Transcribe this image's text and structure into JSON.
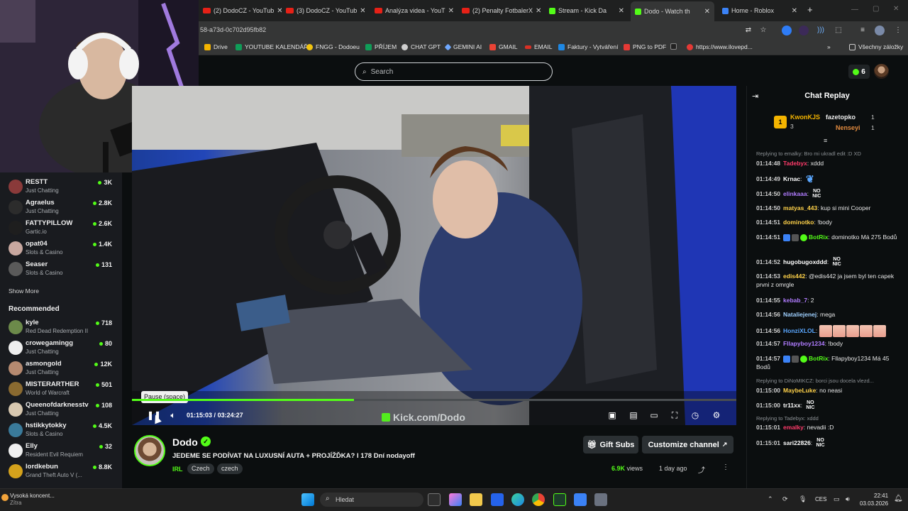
{
  "browser": {
    "tabs": [
      {
        "label": "(2) DodoCZ - YouTub",
        "icon": "youtube-icon"
      },
      {
        "label": "(3) DodoCZ - YouTub",
        "icon": "youtube-icon"
      },
      {
        "label": "Analýza videa - YouT",
        "icon": "youtube-icon"
      },
      {
        "label": "(2) Penalty FotbalerX",
        "icon": "youtube-icon"
      },
      {
        "label": "Stream - Kick Da",
        "icon": "kick-icon"
      },
      {
        "label": "Dodo - Watch th",
        "icon": "kick-icon"
      },
      {
        "label": "Home - Roblox",
        "icon": "roblox-icon"
      }
    ],
    "url": "58-a73d-0c702d95fb82",
    "bookmarks": [
      "Drive",
      "YOUTUBE KALENDÁŘ",
      "FNGG - Dodoeu",
      "PŘÍJEM",
      "CHAT GPT",
      "GEMINI AI",
      "GMAIL",
      "EMAIL",
      "Faktury - Vytváření",
      "PNG to PDF",
      "S",
      "https://www.ilovepd..."
    ],
    "all_bookmarks": "Všechny záložky"
  },
  "header": {
    "search_placeholder": "Search",
    "kick_count": "6"
  },
  "sidebar": {
    "following": [
      {
        "name": "RESTT",
        "category": "Just Chatting",
        "viewers": "3K"
      },
      {
        "name": "Agraelus",
        "category": "Just Chatting",
        "viewers": "2.8K"
      },
      {
        "name": "FATTYPILLOW",
        "category": "Gartic.io",
        "viewers": "2.6K"
      },
      {
        "name": "opat04",
        "category": "Slots & Casino",
        "viewers": "1.4K"
      },
      {
        "name": "Seaser",
        "category": "Slots & Casino",
        "viewers": "131"
      }
    ],
    "show_more": "Show More",
    "recommended_heading": "Recommended",
    "recommended": [
      {
        "name": "kyle",
        "category": "Red Dead Redemption II",
        "viewers": "718"
      },
      {
        "name": "crowegamingg",
        "category": "Just Chatting",
        "viewers": "80"
      },
      {
        "name": "asmongold",
        "category": "Just Chatting",
        "viewers": "12K"
      },
      {
        "name": "MISTERARTHER",
        "category": "World of Warcraft",
        "viewers": "501"
      },
      {
        "name": "Queenofdarknesstv",
        "category": "Just Chatting",
        "viewers": "108"
      },
      {
        "name": "hstikkytokky",
        "category": "Slots & Casino",
        "viewers": "4.5K"
      },
      {
        "name": "Elly",
        "category": "Resident Evil Requiem",
        "viewers": "32"
      },
      {
        "name": "lordkebun",
        "category": "Grand Theft Auto V (...",
        "viewers": "8.8K"
      }
    ]
  },
  "player": {
    "tooltip": "Pause (space)",
    "current_time": "01:15:03",
    "separator": "/",
    "duration": "03:24:27",
    "progress": 0.367,
    "watermark": "Kick.com/Dodo"
  },
  "stream": {
    "streamer": "Dodo",
    "title": "JEDEME SE PODÍVAT NA LUXUSNÍ AUTA + PROJÍŽĎKA? I 178 Dní nodayoff",
    "category": "IRL",
    "tags": [
      "Czech",
      "czech"
    ],
    "views_number": "6.9K",
    "views_label": "views",
    "ago": "1 day ago",
    "gift_subs": "Gift Subs",
    "customize": "Customize channel"
  },
  "chat": {
    "title": "Chat Replay",
    "top_gifters": [
      {
        "name": "KwonKJS",
        "count": "3"
      },
      {
        "name": "fazetopko",
        "count": "1"
      },
      {
        "name": "Nenseyi",
        "count": "1"
      }
    ],
    "messages": [
      {
        "reply": "Replying to emalky: Bro mi ukradl edit :D XD",
        "time": "01:14:48",
        "user": "Tadebyx",
        "color": "#ff3b6a",
        "text": "xddd"
      },
      {
        "time": "01:14:49",
        "user": "Krnac",
        "color": "#ffffff",
        "text": "",
        "emote": "heart"
      },
      {
        "time": "01:14:50",
        "user": "elinkaaa",
        "color": "#b07cff",
        "text": "",
        "emote": "NO NIC"
      },
      {
        "time": "01:14:50",
        "user": "matyas_443",
        "color": "#ffd24a",
        "text": "kup si mini Cooper"
      },
      {
        "time": "01:14:51",
        "user": "dominotko",
        "color": "#ffd24a",
        "text": "!body"
      },
      {
        "time": "01:14:51",
        "user": "BotRix",
        "color": "#53fc18",
        "text": "dominotko Má 275 Bodů",
        "badges": true
      },
      {
        "time": "01:14:52",
        "user": "hugobugoxddd",
        "color": "#ffffff",
        "text": "",
        "emote": "NO NIC"
      },
      {
        "time": "01:14:53",
        "user": "edis442",
        "color": "#ffd24a",
        "text": "@edis442 ja jsem byl ten capek prvni z omrgle"
      },
      {
        "time": "01:14:55",
        "user": "kebab_7",
        "color": "#b07cff",
        "text": "2"
      },
      {
        "time": "01:14:56",
        "user": "Nataliejenej",
        "color": "#9fd0ff",
        "text": "mega"
      },
      {
        "time": "01:14:56",
        "user": "HonziXLOL",
        "color": "#5aa7ff",
        "text": "",
        "emote": "faces"
      },
      {
        "time": "01:14:57",
        "user": "Fllapyboy1234",
        "color": "#b07cff",
        "text": "!body"
      },
      {
        "time": "01:14:57",
        "user": "BotRix",
        "color": "#53fc18",
        "text": "Fllapyboy1234 Má 45 Bodů",
        "badges": true
      },
      {
        "reply": "Replying to DiNoMIKCZ: borci jsou docela vlezd...",
        "time": "01:15:00",
        "user": "MaybeLuke",
        "color": "#ffd24a",
        "text": "no neasi"
      },
      {
        "time": "01:15:00",
        "user": "tr11xx",
        "color": "#ffffff",
        "text": "",
        "emote": "NO NIC"
      },
      {
        "reply": "Replying to Tadebyx: xddd",
        "time": "01:15:01",
        "user": "emalky",
        "color": "#ff3b6a",
        "text": "nevadii :D"
      },
      {
        "time": "01:15:01",
        "user": "sari22826",
        "color": "#ffffff",
        "text": "",
        "emote": "NO NIC"
      }
    ]
  },
  "taskbar": {
    "weather_title": "Vysoká koncent...",
    "weather_sub": "Zítra",
    "search": "Hledat",
    "lang": "CES",
    "time": "22:41",
    "date": "03.03.2026"
  },
  "colors": {
    "accent": "#53fc18",
    "bg": "#0b0e0f",
    "sidebar": "#191b1f"
  }
}
